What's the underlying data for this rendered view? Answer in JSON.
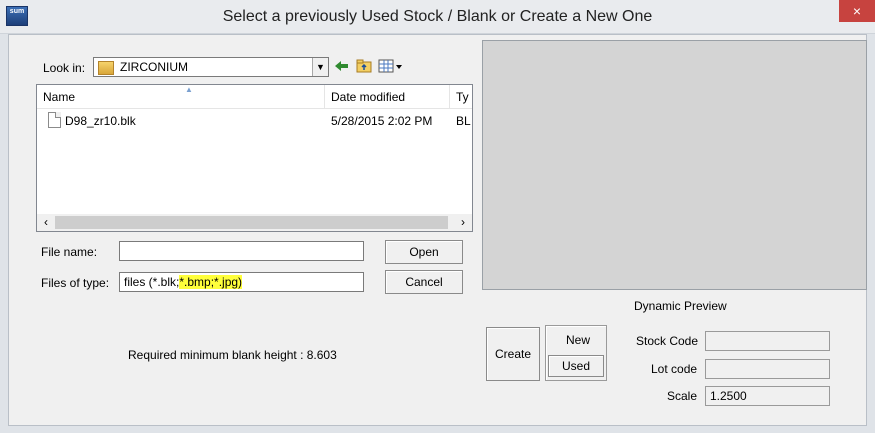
{
  "window": {
    "title": "Select a previously Used Stock / Blank or Create a New One",
    "app_icon_text": "sum",
    "close_glyph": "×"
  },
  "look_in": {
    "label": "Look in:",
    "value": "ZIRCONIUM",
    "toolbar_icons": [
      "back-arrow-icon",
      "up-folder-icon",
      "view-menu-icon"
    ]
  },
  "file_list": {
    "columns": [
      "Name",
      "Date modified",
      "Ty"
    ],
    "rows": [
      {
        "name": "D98_zr10.blk",
        "date": "5/28/2015 2:02 PM",
        "type": "BL"
      }
    ]
  },
  "file_name": {
    "label": "File name:",
    "value": ""
  },
  "files_of_type": {
    "label": "Files of type:",
    "value_plain": "files (*.blk;",
    "value_highlighted": "*.bmp;*.jpg)"
  },
  "buttons": {
    "open": "Open",
    "cancel": "Cancel",
    "create": "Create",
    "new": "New",
    "used": "Used"
  },
  "preview": {
    "caption": "Dynamic Preview"
  },
  "info": {
    "required_height": "Required minimum blank height : 8.603"
  },
  "fields": {
    "stock_code_label": "Stock Code",
    "stock_code_value": "",
    "lot_code_label": "Lot code",
    "lot_code_value": "",
    "scale_label": "Scale",
    "scale_value": "1.2500"
  },
  "colors": {
    "highlight": "#ffff3b",
    "close_button": "#c7433f"
  }
}
